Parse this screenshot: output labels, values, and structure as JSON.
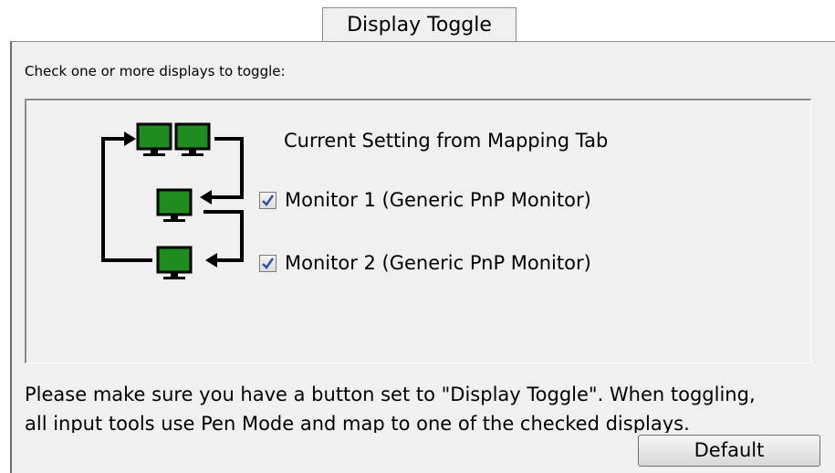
{
  "tab": {
    "label": "Display Toggle"
  },
  "panel": {
    "instruction": "Check one or more displays to toggle:",
    "current_setting_label": "Current Setting from Mapping Tab",
    "monitors": [
      {
        "label": "Monitor 1 (Generic PnP Monitor)",
        "checked": true
      },
      {
        "label": "Monitor 2 (Generic PnP Monitor)",
        "checked": true
      }
    ],
    "note_lines": [
      "Please make sure you have a button set to \"Display Toggle\". When toggling,",
      "all input tools use Pen Mode and map to one of the checked displays."
    ],
    "default_button": "Default"
  },
  "colors": {
    "monitor_green": "#1e8c1e",
    "check_blue": "#2a4fa0"
  }
}
